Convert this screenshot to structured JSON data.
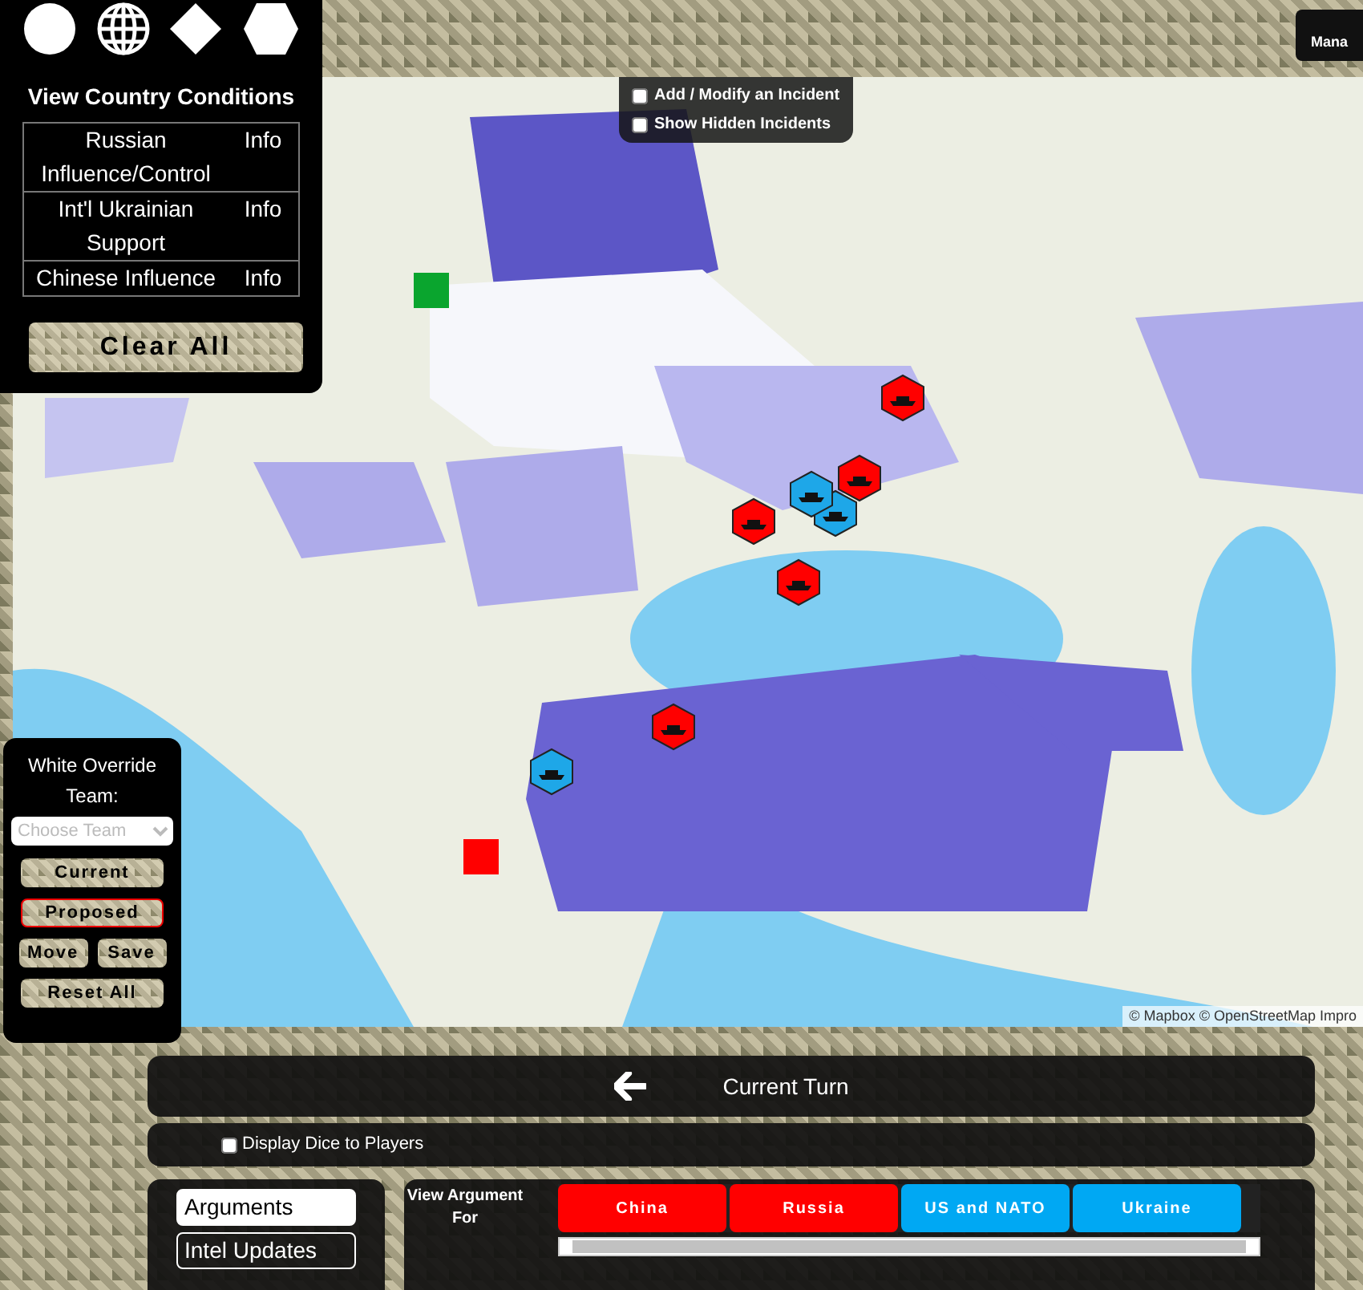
{
  "shape_tools": [
    {
      "kind": "circle"
    },
    {
      "kind": "globe"
    },
    {
      "kind": "diamond"
    },
    {
      "kind": "hexagon"
    }
  ],
  "country_conditions": {
    "title": "View Country Conditions",
    "rows": [
      {
        "label": "Russian Influence/Control",
        "info": "Info"
      },
      {
        "label": "Int'l Ukrainian Support",
        "info": "Info"
      },
      {
        "label": "Chinese Influence",
        "info": "Info"
      }
    ],
    "clear_button": "Clear All"
  },
  "incident_options": [
    {
      "label": "Add / Modify an Incident",
      "checked": false
    },
    {
      "label": "Show Hidden Incidents",
      "checked": false
    }
  ],
  "top_right_button": "Mana",
  "map": {
    "attribution": "© Mapbox © OpenStreetMap Impro",
    "markers": [
      {
        "color": "#ff0000",
        "kind": "hexagon"
      },
      {
        "color": "#ff0000",
        "kind": "hexagon"
      },
      {
        "color": "#1ea7e8",
        "kind": "hexagon"
      },
      {
        "color": "#1ea7e8",
        "kind": "hexagon"
      },
      {
        "color": "#ff0000",
        "kind": "hexagon"
      },
      {
        "color": "#ff0000",
        "kind": "hexagon"
      },
      {
        "color": "#ff0000",
        "kind": "hexagon"
      },
      {
        "color": "#1ea7e8",
        "kind": "hexagon"
      },
      {
        "color": "#ff0000",
        "kind": "square"
      },
      {
        "color": "#0aa52e",
        "kind": "square"
      }
    ]
  },
  "override_panel": {
    "title": "White Override Team:",
    "select_placeholder": "Choose Team",
    "buttons": [
      {
        "label": "Current",
        "selected": false
      },
      {
        "label": "Proposed",
        "selected": true
      },
      {
        "label": "Move",
        "selected": false
      },
      {
        "label": "Save",
        "selected": false
      },
      {
        "label": "Reset All",
        "selected": false
      }
    ]
  },
  "turn_bar": {
    "label": "Current Turn"
  },
  "dice_option": {
    "label": "Display Dice to Players",
    "checked": false
  },
  "side_tabs": [
    {
      "label": "Arguments",
      "selected": true
    },
    {
      "label": "Intel Updates",
      "selected": false
    }
  ],
  "arguments": {
    "title": "View Argument For",
    "teams": [
      {
        "label": "China",
        "color": "#ff0000"
      },
      {
        "label": "Russia",
        "color": "#ff0000"
      },
      {
        "label": "US and NATO",
        "color": "#00a8f3"
      },
      {
        "label": "Ukraine",
        "color": "#00a8f3"
      }
    ]
  }
}
